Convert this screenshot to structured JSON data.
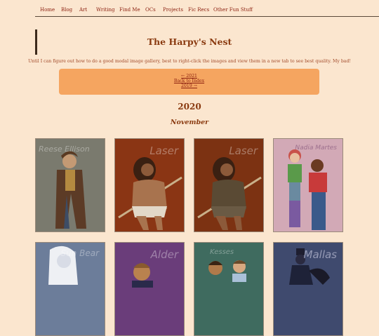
{
  "nav": {
    "items": [
      "Home",
      "Blog",
      "Art",
      "Writing",
      "Find Me",
      "OCs",
      "Projects",
      "Fic Recs",
      "Other Fun Stuff"
    ]
  },
  "page": {
    "title": "The Harpy's Nest",
    "note": "Until I can figure out how to do a good modal image gallery, best to right-click the images and view them in a new tab to see best quality. My bad!"
  },
  "pager": {
    "prev": "← 2021",
    "index": "Back to Index",
    "next": "2019 →"
  },
  "gallery": {
    "year": "2020",
    "month": "November",
    "images": [
      {
        "name": "Reese Ellison",
        "bg": "#7a7a6e"
      },
      {
        "name": "Laser",
        "bg": "#8a3514"
      },
      {
        "name": "Laser",
        "bg": "#7c3212"
      },
      {
        "name": "Nadia Martes",
        "bg": "#d2a9b6"
      },
      {
        "name": "Sun Bear",
        "bg": "#6c7d9a"
      },
      {
        "name": "Alder",
        "bg": "#6a3d7a"
      },
      {
        "name": "Kesses",
        "bg": "#3f6b5f"
      },
      {
        "name": "Mallas",
        "bg": "#3f4a6e"
      }
    ]
  },
  "colors": {
    "background": "#fbe6cf",
    "link": "#8b1f0f",
    "heading": "#8a3a10",
    "pager_box": "#f5a560"
  }
}
